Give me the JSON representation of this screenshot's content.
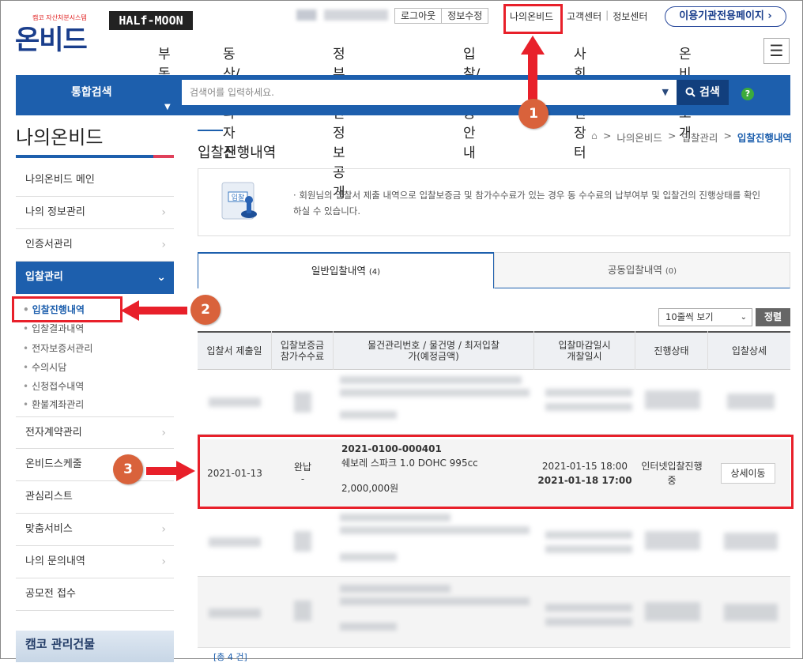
{
  "header": {
    "logo_tagline": "캠코 자산처분시스템",
    "logo_text": "온비드",
    "halfmoon_text": "HALf-MOON",
    "logout_label": "로그아웃",
    "edit_info_label": "정보수정",
    "my_onbid_label": "나의온비드",
    "customer_center_label": "고객센터",
    "info_center_label": "정보센터",
    "agency_page_label": "이용기관전용페이지 ›"
  },
  "nav": [
    "부동산",
    "동산/기타자산",
    "정부재산정보공개",
    "입찰/이용안내",
    "사회공헌장터",
    "온비드소개"
  ],
  "search": {
    "category": "통합검색",
    "placeholder": "검색어를 입력하세요.",
    "button_label": "검색",
    "help_label": "?"
  },
  "sidebar": {
    "title": "나의온비드",
    "items": [
      {
        "label": "나의온비드 메인",
        "chevron": false
      },
      {
        "label": "나의 정보관리",
        "chevron": true
      },
      {
        "label": "인증서관리",
        "chevron": true
      },
      {
        "label": "입찰관리",
        "chevron": true,
        "active": true
      },
      {
        "label": "전자계약관리",
        "chevron": true
      },
      {
        "label": "온비드스케줄",
        "chevron": false
      },
      {
        "label": "관심리스트",
        "chevron": false
      },
      {
        "label": "맞춤서비스",
        "chevron": true
      },
      {
        "label": "나의 문의내역",
        "chevron": true
      },
      {
        "label": "공모전 접수",
        "chevron": false
      }
    ],
    "sub_items": [
      "입찰진행내역",
      "입찰결과내역",
      "전자보증서관리",
      "수의시담",
      "신청접수내역",
      "환불계좌관리"
    ],
    "ad_text": "캠코 관리건물"
  },
  "main": {
    "page_title": "입찰진행내역",
    "breadcrumb": [
      "나의온비드",
      "입찰관리",
      "입찰진행내역"
    ],
    "info_text": "회원님의 입찰서 제출 내역으로 입찰보증금 및 참가수수료가 있는 경우 동 수수료의 납부여부 및 입찰건의 진행상태를 확인하실 수 있습니다.",
    "info_icon_label": "입찰",
    "tabs": [
      {
        "label": "일반입찰내역",
        "count": "(4)"
      },
      {
        "label": "공동입찰내역",
        "count": "(0)"
      }
    ],
    "page_size": "10줄씩 보기",
    "sort_label": "정렬",
    "table": {
      "headers": [
        "입찰서 제출일",
        "입찰보증금 참가수수료",
        "물건관리번호 / 물건명 / 최저입찰가(예정금액)",
        "입찰마감일시 개찰일시",
        "진행상태",
        "입찰상세"
      ],
      "visible_row": {
        "submit_date": "2021-01-13",
        "deposit": "완납",
        "fee": "-",
        "item_no": "2021-0100-000401",
        "item_name": "쉐보레 스파크 1.0 DOHC 995cc",
        "min_price": "2,000,000원",
        "deadline": "2021-01-15 18:00",
        "opening": "2021-01-18 17:00",
        "status": "인터넷입찰진행중",
        "detail_label": "상세이동"
      }
    },
    "total_label": "[총 4 건]"
  },
  "annotations": {
    "badges": [
      "1",
      "2",
      "3"
    ],
    "accent_color": "#e8202a"
  }
}
